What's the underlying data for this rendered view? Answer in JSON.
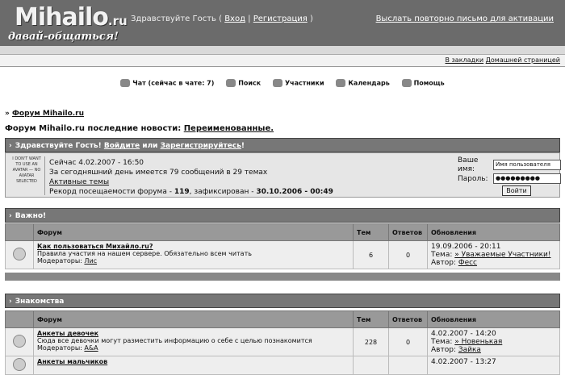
{
  "header": {
    "logo": "Mihailo",
    "logo_tld": ".ru",
    "slogan": "давай-общаться!",
    "greeting": "Здравствуйте Гость ( ",
    "login_link": "Вход",
    "separator": " | ",
    "register_link": "Регистрация",
    "greeting_end": " )",
    "resend_link": "Выслать повторно письмо для активации"
  },
  "bookmarks": {
    "add": "В закладки",
    "home": "Домашней страницей"
  },
  "nav": [
    {
      "label": "Чат (сейчас в чате: 7)",
      "icon": "chat-icon"
    },
    {
      "label": "Поиск",
      "icon": "search-icon"
    },
    {
      "label": "Участники",
      "icon": "members-icon"
    },
    {
      "label": "Календарь",
      "icon": "calendar-icon"
    },
    {
      "label": "Помощь",
      "icon": "help-icon"
    }
  ],
  "breadcrumb": {
    "arrow": "»",
    "label": "Форум Mihailo.ru"
  },
  "news": {
    "prefix": "Форум Mihailo.ru последние новости: ",
    "link": "Переименованные."
  },
  "welcome": {
    "title_prefix": "Здравствуйте Гость! ",
    "login": "Войдите",
    "or": " или ",
    "register": "Зарегистрируйтесь",
    "excl": "!",
    "avatar_text": "I DON'T WANT TO USE AN AVATAR — NO AVATAR SELECTED",
    "now": "Сейчас 4.02.2007 - 16:50",
    "today": "За сегодняшний день имеется 79 сообщений в 29 темах",
    "active": "Активные темы",
    "record_prefix": "Рекорд посещаемости форума - ",
    "record_num": "119",
    "record_mid": ", зафиксирован - ",
    "record_date": "30.10.2006 - 00:49",
    "name_label": "Ваше имя:",
    "name_value": "Имя пользователя",
    "pass_label": "Пароль:",
    "pass_value": "●●●●●●●●●",
    "login_button": "Войти"
  },
  "columns": {
    "forum": "Форум",
    "topics": "Тем",
    "replies": "Ответов",
    "updates": "Обновления"
  },
  "sections": [
    {
      "title": "Важно!",
      "forums": [
        {
          "name": "Как пользоваться Михайло.ru?",
          "desc": "Правила участия на нашем сервере. Обязательно всем читать",
          "mod_label": "Модераторы: ",
          "mod": "Лис",
          "topics": "6",
          "replies": "0",
          "date": "19.09.2006 - 20:11",
          "topic_label": "Тема: ",
          "topic": "» Уважаемые Участники!",
          "author_label": "Автор: ",
          "author": "Фесс"
        }
      ]
    },
    {
      "title": "Знакомства",
      "forums": [
        {
          "name": "Анкеты девочек",
          "desc": "Сюда все девочки могут разместить информацию о себе с целью познакомится",
          "mod_label": "Модераторы: ",
          "mod": "A&A",
          "topics": "228",
          "replies": "0",
          "date": "4.02.2007 - 14:20",
          "topic_label": "Тема: ",
          "topic": "» Новенькая",
          "author_label": "Автор: ",
          "author": "Зайка"
        },
        {
          "name": "Анкеты мальчиков",
          "desc": "",
          "mod_label": "",
          "mod": "",
          "topics": "",
          "replies": "",
          "date": "4.02.2007 - 13:27",
          "topic_label": "",
          "topic": "",
          "author_label": "",
          "author": ""
        }
      ]
    }
  ]
}
